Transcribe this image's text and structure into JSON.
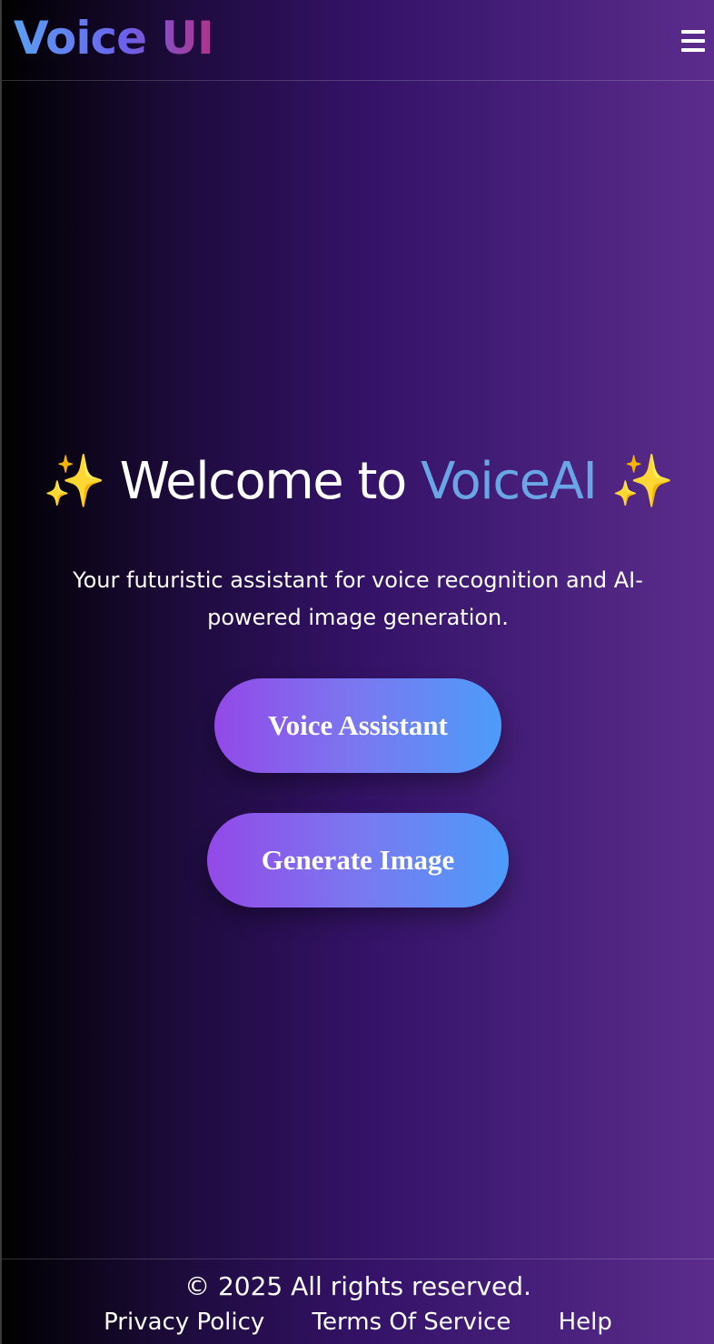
{
  "navbar": {
    "logo_text": "Voice UI",
    "menu_icon": "hamburger-menu-icon"
  },
  "hero": {
    "sparkle_left": "✨",
    "headline_prefix": "Welcome to ",
    "headline_brand": "VoiceAI",
    "sparkle_right": "✨",
    "tagline": "Your futuristic assistant for voice recognition and AI-powered image generation."
  },
  "buttons": {
    "voice_assistant": "Voice Assistant",
    "generate_image": "Generate Image"
  },
  "footer": {
    "copyright": "© 2025 All rights reserved.",
    "links": [
      "Privacy Policy",
      "Terms Of Service",
      "Help"
    ]
  },
  "colors": {
    "brand_blue": "#6aa6e6",
    "sparkle_gold": "#f7d568",
    "button_gradient_start": "#9349e8",
    "button_gradient_end": "#4c9cfa",
    "background_dark": "#000000",
    "background_purple": "#5c2c8c"
  }
}
